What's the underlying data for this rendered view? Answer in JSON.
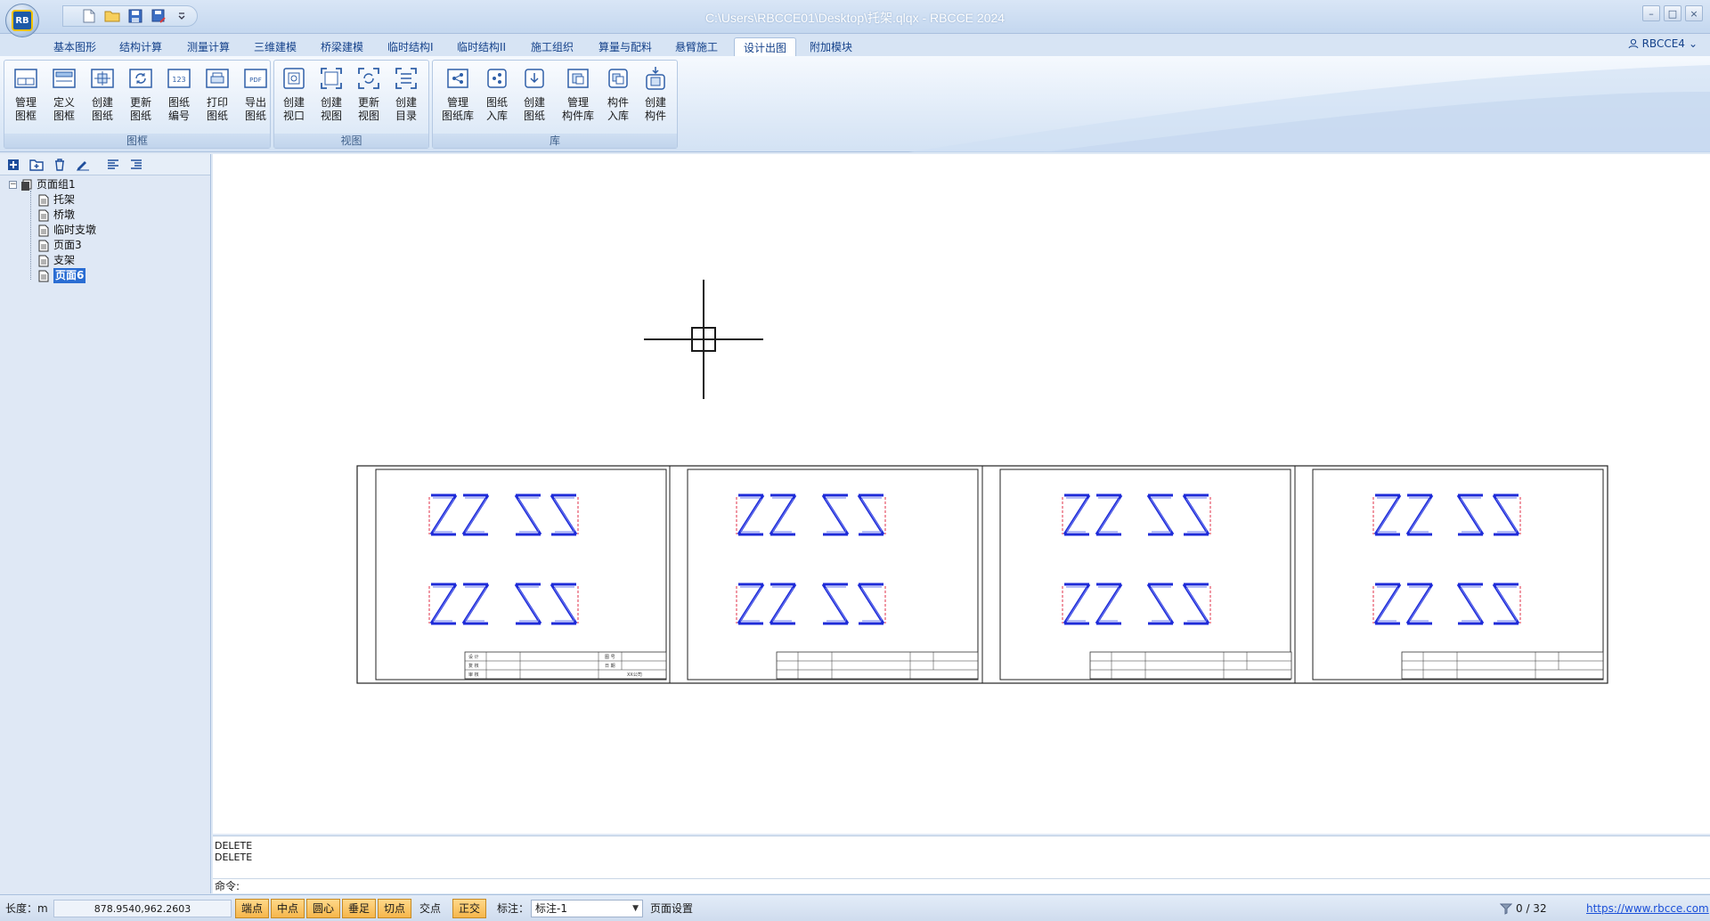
{
  "window": {
    "title": "C:\\Users\\RBCCE01\\Desktop\\托架.qlqx - RBCCE 2024",
    "logo_text": "RB",
    "controls": [
      "–",
      "□",
      "×"
    ]
  },
  "quick_access": {
    "icons": [
      "new-file-icon",
      "open-folder-icon",
      "save-icon",
      "save-as-icon",
      "dropdown-icon"
    ]
  },
  "tabs": [
    {
      "label": "基本图形"
    },
    {
      "label": "结构计算"
    },
    {
      "label": "测量计算"
    },
    {
      "label": "三维建模"
    },
    {
      "label": "桥梁建模"
    },
    {
      "label": "临时结构I"
    },
    {
      "label": "临时结构II"
    },
    {
      "label": "施工组织"
    },
    {
      "label": "算量与配料"
    },
    {
      "label": "悬臂施工"
    },
    {
      "label": "设计出图",
      "active": true
    },
    {
      "label": "附加模块"
    }
  ],
  "user": {
    "name": "RBCCE4",
    "chevron": "⌄"
  },
  "ribbon": {
    "groups": [
      {
        "label": "图框",
        "buttons": [
          {
            "line1": "管理",
            "line2": "图框",
            "icon": "manage-frame-icon"
          },
          {
            "line1": "定义",
            "line2": "图框",
            "icon": "define-frame-icon"
          },
          {
            "line1": "创建",
            "line2": "图纸",
            "icon": "create-sheet-icon"
          },
          {
            "line1": "更新",
            "line2": "图纸",
            "icon": "refresh-sheet-icon"
          },
          {
            "line1": "图纸",
            "line2": "编号",
            "icon": "number-icon",
            "glyph": "123"
          },
          {
            "line1": "打印",
            "line2": "图纸",
            "icon": "print-icon"
          },
          {
            "line1": "导出",
            "line2": "图纸",
            "icon": "pdf-icon",
            "glyph": "PDF"
          }
        ]
      },
      {
        "label": "视图",
        "buttons": [
          {
            "line1": "创建",
            "line2": "视口",
            "icon": "viewport-icon"
          },
          {
            "line1": "创建",
            "line2": "视图",
            "icon": "create-view-icon"
          },
          {
            "line1": "更新",
            "line2": "视图",
            "icon": "refresh-view-icon"
          },
          {
            "line1": "创建",
            "line2": "目录",
            "icon": "catalog-icon"
          }
        ]
      },
      {
        "label": "库",
        "buttons": [
          {
            "line1": "管理",
            "line2": "图纸库",
            "icon": "manage-library-icon"
          },
          {
            "line1": "图纸",
            "line2": "入库",
            "icon": "sheet-to-library-icon"
          },
          {
            "line1": "创建",
            "line2": "图纸",
            "icon": "create-from-library-icon"
          },
          {
            "line1": "管理",
            "line2": "构件库",
            "icon": "component-library-icon"
          },
          {
            "line1": "构件",
            "line2": "入库",
            "icon": "component-to-library-icon"
          },
          {
            "line1": "创建",
            "line2": "构件",
            "icon": "create-component-icon"
          }
        ]
      }
    ]
  },
  "left_panel": {
    "toolbar_icons": [
      "add-page-icon",
      "add-group-icon",
      "delete-icon",
      "rename-icon",
      "align-left-icon",
      "align-indent-icon"
    ],
    "tree": {
      "root": {
        "label": "页面组1",
        "expanded": true,
        "toggle": "−"
      },
      "children": [
        {
          "label": "托架"
        },
        {
          "label": "桥墩"
        },
        {
          "label": "临时支墩"
        },
        {
          "label": "页面3"
        },
        {
          "label": "支架"
        },
        {
          "label": "页面6",
          "selected": true
        }
      ]
    }
  },
  "drawing": {
    "sheet_count": 4,
    "title_block_lines": [
      "设 计",
      "复 核",
      "审 核",
      "图 号",
      "日 期",
      "XX公司"
    ]
  },
  "command": {
    "history": [
      "DELETE",
      "DELETE"
    ],
    "prompt_label": "命令:"
  },
  "status": {
    "length_label": "长度：m",
    "coordinates": "878.9540,962.2603",
    "snaps": [
      {
        "label": "端点",
        "on": true
      },
      {
        "label": "中点",
        "on": true
      },
      {
        "label": "圆心",
        "on": true
      },
      {
        "label": "垂足",
        "on": true
      },
      {
        "label": "切点",
        "on": true
      },
      {
        "label": "交点",
        "on": false
      },
      {
        "label": "正交",
        "on": true
      }
    ],
    "dim_label": "标注：",
    "dim_value": "标注-1",
    "page_settings": "页面设置",
    "filter_count": "0 / 32",
    "website": "https://www.rbcce.com"
  },
  "colors": {
    "ribbon_bg": "#e0ebf8",
    "accent_blue": "#15428b",
    "snap_on": "#f6b64b",
    "drawing_blue": "#1e2bd8",
    "drawing_red": "#e0304a"
  }
}
